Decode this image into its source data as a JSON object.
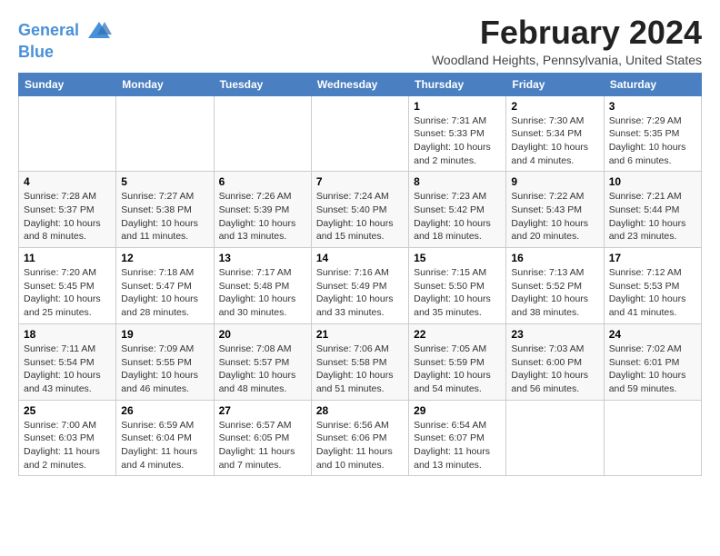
{
  "logo": {
    "line1": "General",
    "line2": "Blue"
  },
  "title": "February 2024",
  "location": "Woodland Heights, Pennsylvania, United States",
  "days_of_week": [
    "Sunday",
    "Monday",
    "Tuesday",
    "Wednesday",
    "Thursday",
    "Friday",
    "Saturday"
  ],
  "weeks": [
    [
      {
        "num": "",
        "sunrise": "",
        "sunset": "",
        "daylight": ""
      },
      {
        "num": "",
        "sunrise": "",
        "sunset": "",
        "daylight": ""
      },
      {
        "num": "",
        "sunrise": "",
        "sunset": "",
        "daylight": ""
      },
      {
        "num": "",
        "sunrise": "",
        "sunset": "",
        "daylight": ""
      },
      {
        "num": "1",
        "sunrise": "Sunrise: 7:31 AM",
        "sunset": "Sunset: 5:33 PM",
        "daylight": "Daylight: 10 hours and 2 minutes."
      },
      {
        "num": "2",
        "sunrise": "Sunrise: 7:30 AM",
        "sunset": "Sunset: 5:34 PM",
        "daylight": "Daylight: 10 hours and 4 minutes."
      },
      {
        "num": "3",
        "sunrise": "Sunrise: 7:29 AM",
        "sunset": "Sunset: 5:35 PM",
        "daylight": "Daylight: 10 hours and 6 minutes."
      }
    ],
    [
      {
        "num": "4",
        "sunrise": "Sunrise: 7:28 AM",
        "sunset": "Sunset: 5:37 PM",
        "daylight": "Daylight: 10 hours and 8 minutes."
      },
      {
        "num": "5",
        "sunrise": "Sunrise: 7:27 AM",
        "sunset": "Sunset: 5:38 PM",
        "daylight": "Daylight: 10 hours and 11 minutes."
      },
      {
        "num": "6",
        "sunrise": "Sunrise: 7:26 AM",
        "sunset": "Sunset: 5:39 PM",
        "daylight": "Daylight: 10 hours and 13 minutes."
      },
      {
        "num": "7",
        "sunrise": "Sunrise: 7:24 AM",
        "sunset": "Sunset: 5:40 PM",
        "daylight": "Daylight: 10 hours and 15 minutes."
      },
      {
        "num": "8",
        "sunrise": "Sunrise: 7:23 AM",
        "sunset": "Sunset: 5:42 PM",
        "daylight": "Daylight: 10 hours and 18 minutes."
      },
      {
        "num": "9",
        "sunrise": "Sunrise: 7:22 AM",
        "sunset": "Sunset: 5:43 PM",
        "daylight": "Daylight: 10 hours and 20 minutes."
      },
      {
        "num": "10",
        "sunrise": "Sunrise: 7:21 AM",
        "sunset": "Sunset: 5:44 PM",
        "daylight": "Daylight: 10 hours and 23 minutes."
      }
    ],
    [
      {
        "num": "11",
        "sunrise": "Sunrise: 7:20 AM",
        "sunset": "Sunset: 5:45 PM",
        "daylight": "Daylight: 10 hours and 25 minutes."
      },
      {
        "num": "12",
        "sunrise": "Sunrise: 7:18 AM",
        "sunset": "Sunset: 5:47 PM",
        "daylight": "Daylight: 10 hours and 28 minutes."
      },
      {
        "num": "13",
        "sunrise": "Sunrise: 7:17 AM",
        "sunset": "Sunset: 5:48 PM",
        "daylight": "Daylight: 10 hours and 30 minutes."
      },
      {
        "num": "14",
        "sunrise": "Sunrise: 7:16 AM",
        "sunset": "Sunset: 5:49 PM",
        "daylight": "Daylight: 10 hours and 33 minutes."
      },
      {
        "num": "15",
        "sunrise": "Sunrise: 7:15 AM",
        "sunset": "Sunset: 5:50 PM",
        "daylight": "Daylight: 10 hours and 35 minutes."
      },
      {
        "num": "16",
        "sunrise": "Sunrise: 7:13 AM",
        "sunset": "Sunset: 5:52 PM",
        "daylight": "Daylight: 10 hours and 38 minutes."
      },
      {
        "num": "17",
        "sunrise": "Sunrise: 7:12 AM",
        "sunset": "Sunset: 5:53 PM",
        "daylight": "Daylight: 10 hours and 41 minutes."
      }
    ],
    [
      {
        "num": "18",
        "sunrise": "Sunrise: 7:11 AM",
        "sunset": "Sunset: 5:54 PM",
        "daylight": "Daylight: 10 hours and 43 minutes."
      },
      {
        "num": "19",
        "sunrise": "Sunrise: 7:09 AM",
        "sunset": "Sunset: 5:55 PM",
        "daylight": "Daylight: 10 hours and 46 minutes."
      },
      {
        "num": "20",
        "sunrise": "Sunrise: 7:08 AM",
        "sunset": "Sunset: 5:57 PM",
        "daylight": "Daylight: 10 hours and 48 minutes."
      },
      {
        "num": "21",
        "sunrise": "Sunrise: 7:06 AM",
        "sunset": "Sunset: 5:58 PM",
        "daylight": "Daylight: 10 hours and 51 minutes."
      },
      {
        "num": "22",
        "sunrise": "Sunrise: 7:05 AM",
        "sunset": "Sunset: 5:59 PM",
        "daylight": "Daylight: 10 hours and 54 minutes."
      },
      {
        "num": "23",
        "sunrise": "Sunrise: 7:03 AM",
        "sunset": "Sunset: 6:00 PM",
        "daylight": "Daylight: 10 hours and 56 minutes."
      },
      {
        "num": "24",
        "sunrise": "Sunrise: 7:02 AM",
        "sunset": "Sunset: 6:01 PM",
        "daylight": "Daylight: 10 hours and 59 minutes."
      }
    ],
    [
      {
        "num": "25",
        "sunrise": "Sunrise: 7:00 AM",
        "sunset": "Sunset: 6:03 PM",
        "daylight": "Daylight: 11 hours and 2 minutes."
      },
      {
        "num": "26",
        "sunrise": "Sunrise: 6:59 AM",
        "sunset": "Sunset: 6:04 PM",
        "daylight": "Daylight: 11 hours and 4 minutes."
      },
      {
        "num": "27",
        "sunrise": "Sunrise: 6:57 AM",
        "sunset": "Sunset: 6:05 PM",
        "daylight": "Daylight: 11 hours and 7 minutes."
      },
      {
        "num": "28",
        "sunrise": "Sunrise: 6:56 AM",
        "sunset": "Sunset: 6:06 PM",
        "daylight": "Daylight: 11 hours and 10 minutes."
      },
      {
        "num": "29",
        "sunrise": "Sunrise: 6:54 AM",
        "sunset": "Sunset: 6:07 PM",
        "daylight": "Daylight: 11 hours and 13 minutes."
      },
      {
        "num": "",
        "sunrise": "",
        "sunset": "",
        "daylight": ""
      },
      {
        "num": "",
        "sunrise": "",
        "sunset": "",
        "daylight": ""
      }
    ]
  ]
}
